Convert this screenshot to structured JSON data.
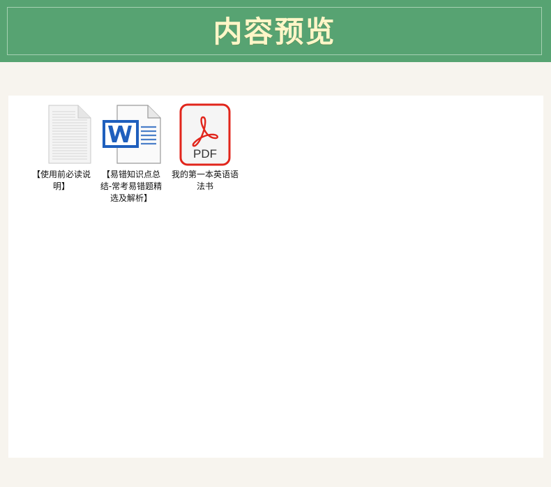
{
  "header": {
    "title": "内容预览"
  },
  "files": [
    {
      "name": "【使用前必读说明】",
      "icon": "text-document-icon"
    },
    {
      "name": "【易错知识点总结-常考易错题精选及解析】",
      "icon": "word-document-icon"
    },
    {
      "name": "我的第一本英语语法书",
      "icon": "pdf-document-icon"
    }
  ],
  "colors": {
    "header_bg": "#57a372",
    "title_color": "#fff6c8",
    "page_bg": "#f7f4ee",
    "word_blue": "#1f5fbd",
    "pdf_red": "#e1251b"
  }
}
